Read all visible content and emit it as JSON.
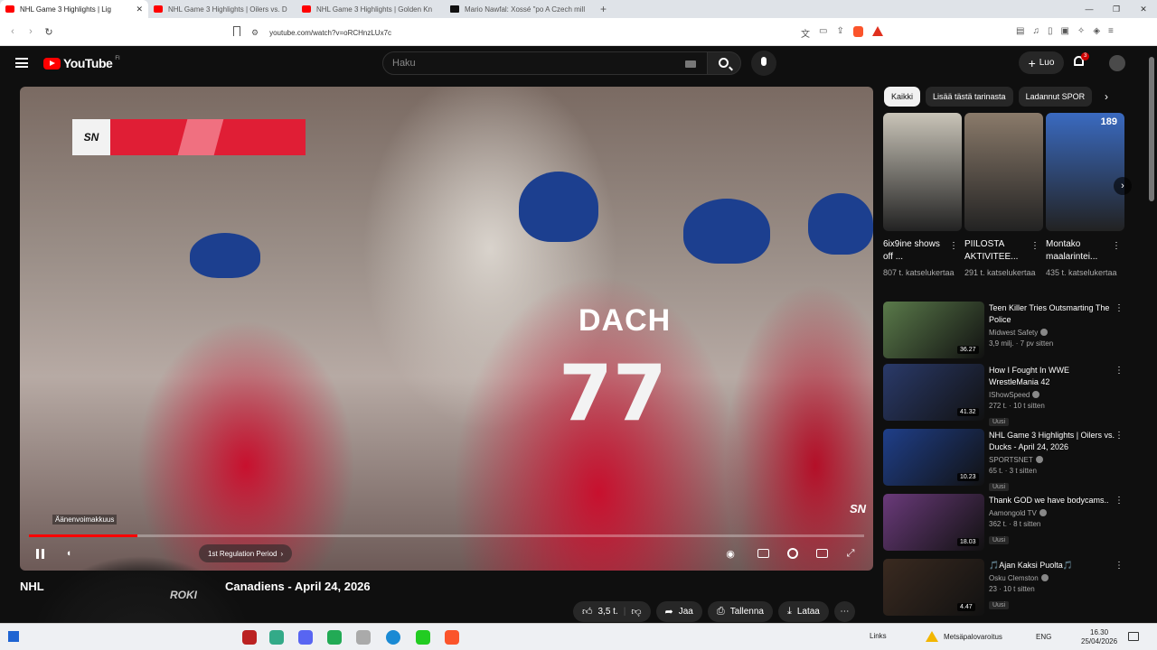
{
  "browser": {
    "tabs": [
      {
        "title": "NHL Game 3 Highlights | Lig",
        "icon": "youtube-icon",
        "active": true
      },
      {
        "title": "NHL Game 3 Highlights | Oilers vs. D",
        "icon": "youtube-icon",
        "active": false
      },
      {
        "title": "NHL Game 3 Highlights | Golden Kn",
        "icon": "youtube-icon",
        "active": false
      },
      {
        "title": "Mario Nawfal: Xossé \"po A Czech mill",
        "icon": "x-icon",
        "active": false
      }
    ],
    "new_tab": "+",
    "url": "youtube.com/watch?v=oRCHnzLUx7c"
  },
  "header": {
    "logo_text": "YouTube",
    "country_code": "FI",
    "search_placeholder": "Haku",
    "create_label": "Luo",
    "notification_count": "3"
  },
  "player": {
    "jersey_name": "DACH",
    "jersey_number": "77",
    "network_logo": "SN",
    "tooltip": "Äänenvoimakkuus",
    "chapter": "1st Regulation Period",
    "progress": 0.13
  },
  "video": {
    "title_start": "NHL",
    "title_end": "Canadiens - April 24, 2026",
    "webcam_logo": "ROKI",
    "likes": "3,5 t.",
    "share": "Jaa",
    "save": "Tallenna",
    "download": "Lataa"
  },
  "sidebar": {
    "chips": [
      "Kaikki",
      "Lisää tästä tarinasta",
      "Ladannut SPOR"
    ],
    "shorts": [
      {
        "title": "6ix9ine shows off ...",
        "views": "807 t. katselukertaa",
        "color": "#c9c4b8"
      },
      {
        "title": "PIILOSTA AKTIVITEE...",
        "views": "291 t. katselukertaa",
        "color": "#8a7a6a"
      },
      {
        "title": "Montako maalarintei...",
        "views": "435 t. katselukertaa",
        "color": "#3a6ac0",
        "count": "189"
      }
    ],
    "recommendations": [
      {
        "title": "Teen Killer Tries Outsmarting The Police",
        "channel": "Midwest Safety",
        "meta": "3,9 milj. · 7 pv sitten",
        "badge": "",
        "duration": "36.27",
        "color": "#5a7a4a"
      },
      {
        "title": "How I Fought In WWE WrestleMania 42",
        "channel": "IShowSpeed",
        "meta": "272 t. · 10 t sitten",
        "badge": "Uusi",
        "duration": "41.32",
        "color": "#2a3a6a"
      },
      {
        "title": "NHL Game 3 Highlights | Oilers vs. Ducks - April 24, 2026",
        "channel": "SPORTSNET",
        "meta": "65 t. · 3 t sitten",
        "badge": "Uusi",
        "duration": "10.23",
        "color": "#1f3f8a"
      },
      {
        "title": "Thank GOD we have bodycams..",
        "channel": "Aamongold TV",
        "meta": "362 t. · 8 t sitten",
        "badge": "Uusi",
        "duration": "18.03",
        "color": "#6a3a7a"
      },
      {
        "title": "🎵Ajan Kaksi Puolta🎵",
        "channel": "Osku Clemston",
        "meta": "23 · 10 t sitten",
        "badge": "Uusi",
        "duration": "4.47",
        "color": "#3a2a20"
      }
    ]
  },
  "taskbar": {
    "links": "Links",
    "weather": "Metsäpalovaroitus",
    "lang": "ENG",
    "time": "16.30",
    "date": "25/04/2026"
  }
}
